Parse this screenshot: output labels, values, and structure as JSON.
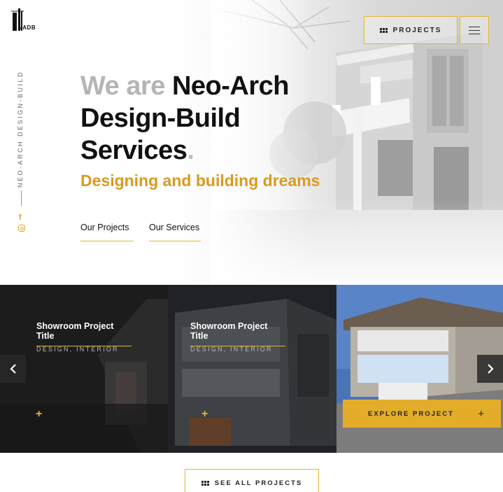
{
  "brand": {
    "logo_text": "NADB"
  },
  "nav": {
    "projects_label": "PROJECTS",
    "projects_icon": "grid-icon",
    "menu_icon": "hamburger-icon"
  },
  "sidebar": {
    "vertical_text": "NEO-ARCH DESIGN-BUILD",
    "social": [
      "facebook-icon",
      "instagram-icon"
    ]
  },
  "hero": {
    "headline_muted": "We are ",
    "headline_main_1": "Neo-Arch",
    "headline_main_2": "Design-Build",
    "headline_main_3": "Services",
    "headline_dot": ".",
    "tagline": "Designing and building dreams",
    "link_projects": "Our Projects",
    "link_services": "Our Services"
  },
  "projects": {
    "cards": [
      {
        "title": "Showroom Project Title",
        "tags": "DESIGN, INTERIOR",
        "plus": "+"
      },
      {
        "title": "Showroom Project Title",
        "tags": "DESIGN, INTERIOR",
        "plus": "+"
      },
      {
        "explore_label": "EXPLORE PROJECT",
        "plus": "+"
      }
    ],
    "see_all_label": "SEE ALL PROJECTS"
  },
  "colors": {
    "accent": "#e6b52c",
    "tagline": "#d99a20",
    "dark": "#111111"
  }
}
